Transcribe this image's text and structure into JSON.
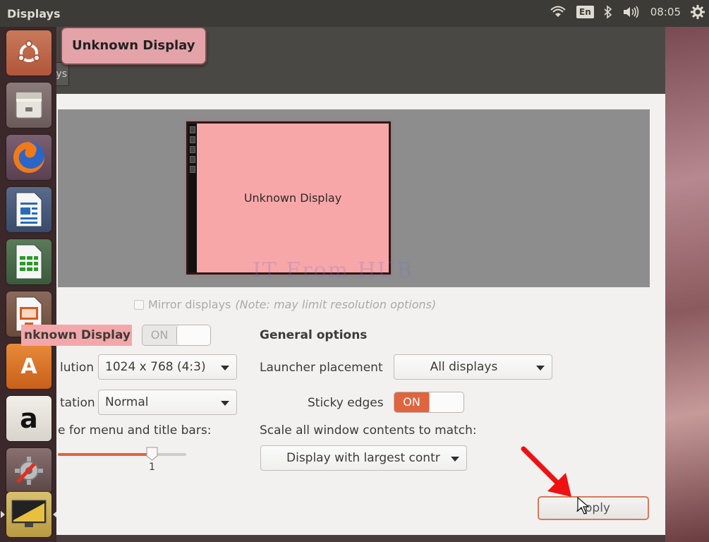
{
  "top_panel": {
    "title": "Displays",
    "language": "En",
    "time": "08:05",
    "icons": [
      "wifi-icon",
      "bluetooth-icon",
      "volume-icon",
      "gear-icon"
    ]
  },
  "launcher": {
    "items": [
      "ubuntu-dash",
      "files",
      "firefox",
      "libreoffice-writer",
      "libreoffice-calc",
      "libreoffice-impress",
      "ubuntu-software-center",
      "amazon",
      "system-settings",
      "displays"
    ],
    "amazon_glyph": "a",
    "software_glyph": "A"
  },
  "header": {
    "back_label": "ys",
    "tooltip": "Unknown Display"
  },
  "preview": {
    "monitor_label": "Unknown Display",
    "watermark": "IT From HUB"
  },
  "mirror": {
    "label": "Mirror displays",
    "note": "(Note: may limit resolution options)"
  },
  "display": {
    "name": "nknown Display",
    "power_switch": {
      "left": "ON",
      "state": "off"
    },
    "resolution_label": "lution",
    "resolution_value": "1024 x 768 (4:3)",
    "rotation_label": "tation",
    "rotation_value": "Normal",
    "scale_label": "e for menu and title bars:",
    "scale_value": "1",
    "scale_fraction": 0.74
  },
  "general": {
    "title": "General options",
    "launcher_placement_label": "Launcher placement",
    "launcher_placement_value": "All displays",
    "sticky_edges_label": "Sticky edges",
    "sticky_switch": {
      "left": "ON",
      "state": "on"
    },
    "scale_all_label": "Scale all window contents to match:",
    "scale_all_value": "Display with largest contr"
  },
  "apply_label": "Apply",
  "colors": {
    "accent": "#e0643e",
    "highlight": "#f4a7aa",
    "arrow": "#ee1111"
  }
}
